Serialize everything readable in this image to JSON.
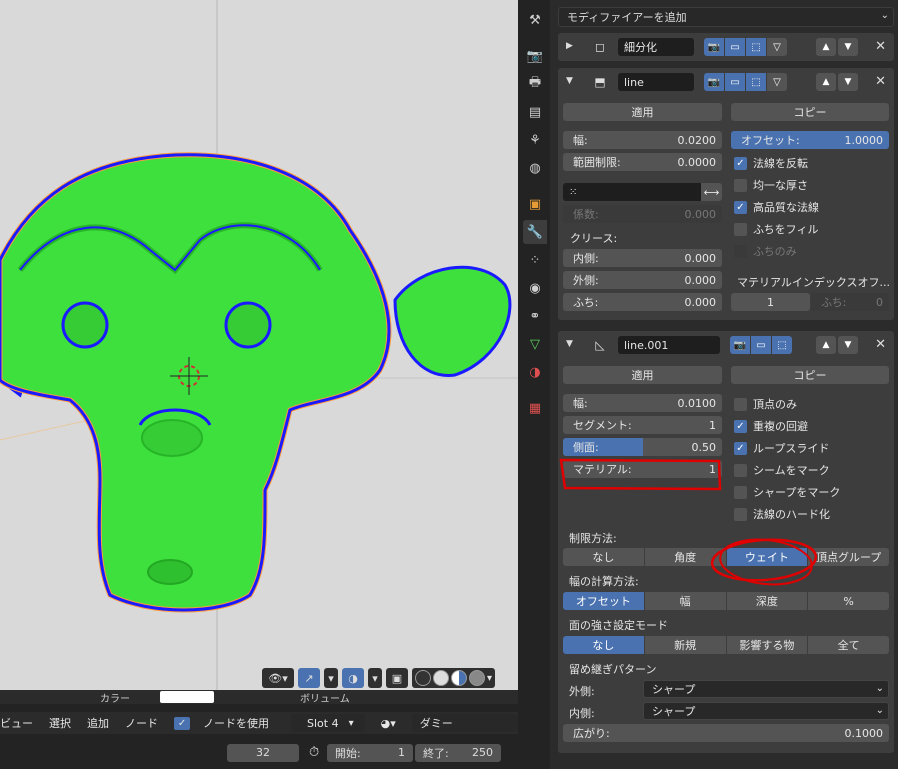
{
  "viewport": {
    "toolbar_icons": [
      "eye-icon",
      "gizmo-icon",
      "overlay-icon",
      "xray-icon",
      "wireframe-shading-icon",
      "solid-shading-icon",
      "material-shading-icon",
      "rendered-shading-icon"
    ]
  },
  "node_header": {
    "strip_left": "カラー",
    "strip_right": "ボリューム",
    "menu": [
      "ビュー",
      "選択",
      "追加",
      "ノード"
    ],
    "use_nodes_label": "ノードを使用",
    "slot": "Slot 4",
    "material": "ダミー"
  },
  "timeline": {
    "current_frame": "32",
    "start_label": "開始:",
    "start": "1",
    "end_label": "終了:",
    "end": "250"
  },
  "tabs": [
    "tool-icon",
    "render-icon",
    "output-icon",
    "view-layer-icon",
    "scene-icon",
    "world-icon",
    "object-icon",
    "modifier-icon",
    "particles-icon",
    "physics-icon",
    "constraints-icon",
    "data-icon",
    "material-icon",
    "texture-icon"
  ],
  "properties": {
    "add_modifier": "モディファイアーを追加",
    "modifiers": [
      {
        "name": "細分化",
        "collapsed": true
      },
      {
        "name": "line",
        "apply": "適用",
        "copy": "コピー",
        "width_label": "幅:",
        "width": "0.0200",
        "offset_label": "オフセット:",
        "offset": "1.0000",
        "clamp_label": "範囲制限:",
        "clamp": "0.0000",
        "flip_normals": "法線を反転",
        "even_thickness": "均一な厚さ",
        "high_quality_normals": "高品質な法線",
        "fill_rim": "ふちをフィル",
        "rim_only": "ふちのみ",
        "factor_label": "係数:",
        "factor": "0.000",
        "crease_label": "クリース:",
        "inner_label": "内側:",
        "inner": "0.000",
        "outer_label": "外側:",
        "outer": "0.000",
        "rim_label": "ふち:",
        "rim": "0.000",
        "material_index_label": "マテリアルインデックスオフ...",
        "mat_index": "1",
        "rim_mat_label": "ふち:",
        "rim_mat": "0"
      },
      {
        "name": "line.001",
        "apply": "適用",
        "copy": "コピー",
        "width_label": "幅:",
        "width": "0.0100",
        "segments_label": "セグメント:",
        "segments": "1",
        "side_label": "側面:",
        "side": "0.50",
        "material_label": "マテリアル:",
        "material": "1",
        "vertices_only": "頂点のみ",
        "clamp_overlap": "重複の回避",
        "loop_slide": "ループスライド",
        "mark_seam": "シームをマーク",
        "mark_sharp": "シャープをマーク",
        "harden_normals": "法線のハード化",
        "limit_method_label": "制限方法:",
        "limit_methods": [
          "なし",
          "角度",
          "ウェイト",
          "頂点グループ"
        ],
        "width_method_label": "幅の計算方法:",
        "width_methods": [
          "オフセット",
          "幅",
          "深度",
          "%"
        ],
        "face_strength_label": "面の強さ設定モード",
        "face_strengths": [
          "なし",
          "新規",
          "影響する物",
          "全て"
        ],
        "miter_label": "留め継ぎパターン",
        "outer_miter_label": "外側:",
        "outer_miter": "シャープ",
        "inner_miter_label": "内側:",
        "inner_miter": "シャープ",
        "spread_label": "広がり:",
        "spread": "0.1000"
      }
    ]
  },
  "colors": {
    "accent": "#4a72b0",
    "annotation": "#e00000",
    "mesh": "#3ee03e",
    "outline": "#1a1aff"
  }
}
